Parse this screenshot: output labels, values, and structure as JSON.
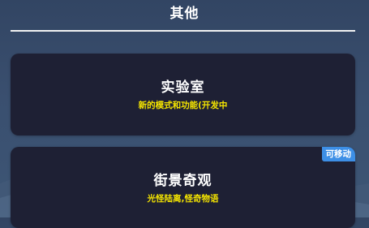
{
  "header": {
    "title": "其他"
  },
  "cards": [
    {
      "title": "实验室",
      "subtitle": "新的模式和功能(开发中"
    },
    {
      "title": "街景奇观",
      "subtitle": "光怪陆离,怪奇物语",
      "badge": "可移动"
    }
  ],
  "colors": {
    "background_top": "#324563",
    "background_bottom": "#3e5675",
    "card_background": "#1e2034",
    "title_text": "#ffffff",
    "subtitle_text": "#f4e400",
    "badge_background": "#3d8fe6"
  }
}
